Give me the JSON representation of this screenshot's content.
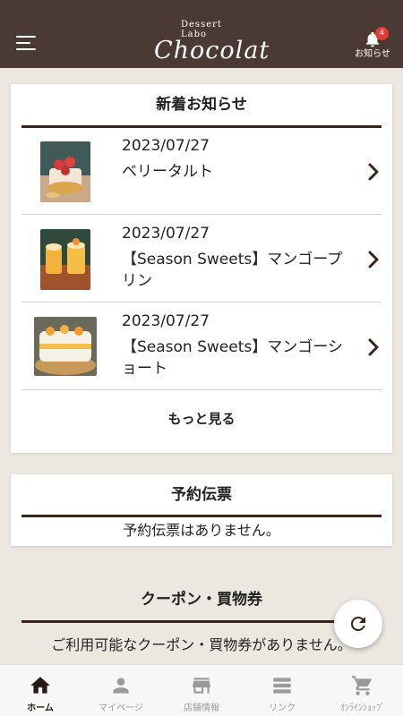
{
  "header": {
    "logo_sub": "Dessert Labo",
    "logo_main": "Chocolat",
    "notice_label": "お知らせ",
    "notice_badge": "4",
    "colors": {
      "background": "#4a3a33",
      "badge": "#e53935"
    }
  },
  "news": {
    "title": "新着お知らせ",
    "items": [
      {
        "date": "2023/07/27",
        "title": "ベリータルト",
        "image": "berry-tart-photo"
      },
      {
        "date": "2023/07/27",
        "title": "【Season Sweets】マンゴープリン",
        "image": "mango-pudding-photo"
      },
      {
        "date": "2023/07/27",
        "title": "【Season Sweets】マンゴーショート",
        "image": "mango-shortcake-photo"
      }
    ],
    "more_label": "もっと見る"
  },
  "reservation": {
    "title": "予約伝票",
    "empty_text": "予約伝票はありません。"
  },
  "coupon": {
    "title": "クーポン・買物券",
    "empty_text": "ご利用可能なクーポン・買物券がありません。"
  },
  "tabs": [
    {
      "label": "ホーム",
      "icon": "home-icon",
      "active": true
    },
    {
      "label": "マイページ",
      "icon": "person-icon",
      "active": false
    },
    {
      "label": "店舗情報",
      "icon": "store-icon",
      "active": false
    },
    {
      "label": "リンク",
      "icon": "list-icon",
      "active": false
    },
    {
      "label": "ｵﾝﾗｲﾝｼｮｯﾌﾟ",
      "icon": "cart-icon",
      "active": false
    }
  ],
  "colors": {
    "accent": "#3b2417",
    "page_background": "#ece8e0"
  }
}
